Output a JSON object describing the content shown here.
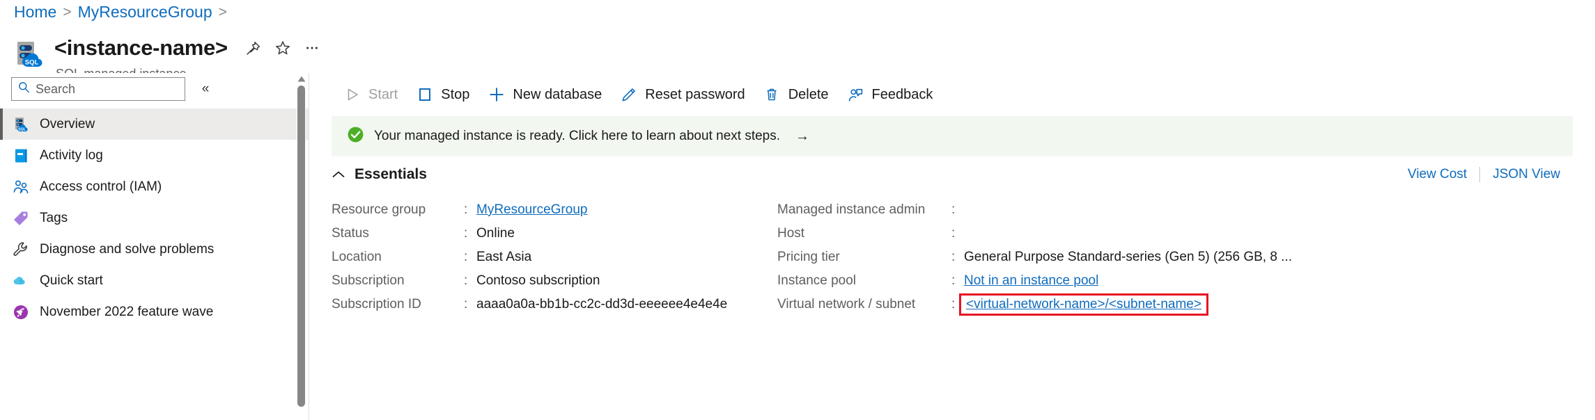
{
  "breadcrumb": {
    "items": [
      "Home",
      "MyResourceGroup"
    ],
    "separator": ">"
  },
  "resource": {
    "title": "<instance-name>",
    "subtitle": "SQL managed instance",
    "icon": "sql-managed-instance-icon",
    "actions": {
      "pin": "pin-icon",
      "favorite": "star-icon",
      "more": "ellipsis-icon"
    }
  },
  "sidebar": {
    "search": {
      "placeholder": "Search",
      "value": ""
    },
    "collapse_label": "«",
    "items": [
      {
        "label": "Overview",
        "icon": "sql-managed-instance-icon",
        "active": true
      },
      {
        "label": "Activity log",
        "icon": "activity-log-icon",
        "active": false
      },
      {
        "label": "Access control (IAM)",
        "icon": "access-control-icon",
        "active": false
      },
      {
        "label": "Tags",
        "icon": "tag-icon",
        "active": false
      },
      {
        "label": "Diagnose and solve problems",
        "icon": "wrench-icon",
        "active": false
      },
      {
        "label": "Quick start",
        "icon": "quick-start-icon",
        "active": false
      },
      {
        "label": "November 2022 feature wave",
        "icon": "rocket-icon",
        "active": false
      }
    ]
  },
  "toolbar": {
    "commands": [
      {
        "label": "Start",
        "icon": "play-icon",
        "disabled": true
      },
      {
        "label": "Stop",
        "icon": "stop-icon",
        "disabled": false
      },
      {
        "label": "New database",
        "icon": "plus-icon",
        "disabled": false
      },
      {
        "label": "Reset password",
        "icon": "pencil-icon",
        "disabled": false
      },
      {
        "label": "Delete",
        "icon": "trash-icon",
        "disabled": false
      },
      {
        "label": "Feedback",
        "icon": "feedback-icon",
        "disabled": false
      }
    ]
  },
  "banner": {
    "icon": "success-check-icon",
    "text": "Your managed instance is ready. Click here to learn about next steps.",
    "arrow": "→",
    "background": "#f2f8f0",
    "icon_color": "#4caf27"
  },
  "essentials": {
    "title": "Essentials",
    "chevron": "chevron-up-icon",
    "links": [
      {
        "label": "View Cost"
      },
      {
        "label": "JSON View"
      }
    ],
    "left_properties": [
      {
        "key": "Resource group",
        "value": "MyResourceGroup",
        "link": true
      },
      {
        "key": "Status",
        "value": "Online",
        "link": false
      },
      {
        "key": "Location",
        "value": "East Asia",
        "link": false
      },
      {
        "key": "Subscription",
        "value": "Contoso subscription",
        "link": false
      },
      {
        "key": "Subscription ID",
        "value": "aaaa0a0a-bb1b-cc2c-dd3d-eeeeee4e4e4e",
        "link": false
      }
    ],
    "right_properties": [
      {
        "key": "Managed instance admin",
        "value": "",
        "link": false,
        "highlight": false
      },
      {
        "key": "Host",
        "value": "",
        "link": false,
        "highlight": false
      },
      {
        "key": "Pricing tier",
        "value": "General Purpose Standard-series (Gen 5) (256 GB, 8 ...",
        "link": false,
        "highlight": false
      },
      {
        "key": "Instance pool",
        "value": "Not in an instance pool",
        "link": true,
        "highlight": false
      },
      {
        "key": "Virtual network / subnet",
        "value": "<virtual-network-name>/<subnet-name>",
        "link": true,
        "highlight": true
      }
    ],
    "colon": ":"
  },
  "colors": {
    "accent_link": "#0f6cbd",
    "highlight_border": "#e81123",
    "banner_bg": "#f2f8f0",
    "active_nav_bg": "#edebe9"
  }
}
